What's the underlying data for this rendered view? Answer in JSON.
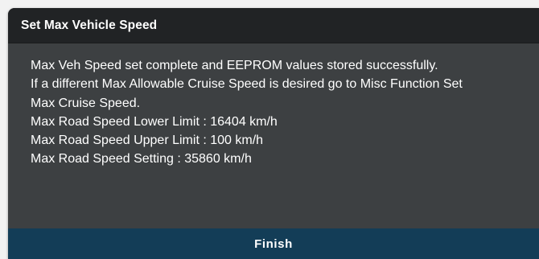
{
  "dialog": {
    "title": "Set Max Vehicle Speed",
    "message_lines": [
      "Max Veh Speed set complete and EEPROM values stored successfully.",
      "If a different Max Allowable Cruise Speed is desired go to Misc Function Set",
      "Max Cruise Speed.",
      "Max Road Speed Lower Limit : 16404 km/h",
      "Max Road Speed Upper Limit : 100 km/h",
      "Max Road Speed Setting : 35860 km/h"
    ],
    "finish_label": "Finish"
  },
  "colors": {
    "title_bar": "#212325",
    "body": "#3d4042",
    "footer_button": "#133d57",
    "text": "#ffffff"
  }
}
